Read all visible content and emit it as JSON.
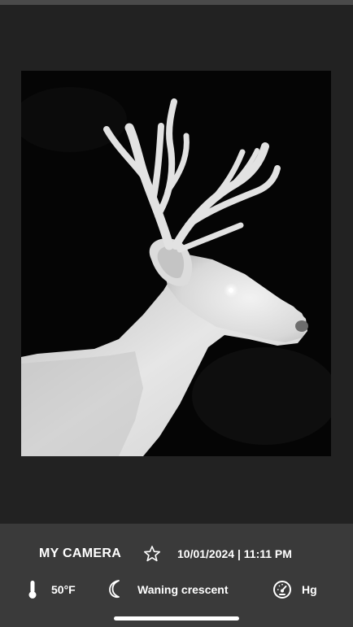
{
  "photo": {
    "subject": "deer-trail-camera-night-photo"
  },
  "info": {
    "camera_name": "MY CAMERA",
    "timestamp": "10/01/2024 | 11:11 PM",
    "temperature": "50°F",
    "moon_phase": "Waning crescent",
    "pressure": "Hg"
  },
  "icons": {
    "favorite": "star-outline-icon",
    "temperature": "thermometer-icon",
    "moon": "crescent-moon-icon",
    "pressure": "gauge-icon"
  },
  "colors": {
    "background": "#222222",
    "panel": "#3a3a3a",
    "text": "#ffffff"
  }
}
